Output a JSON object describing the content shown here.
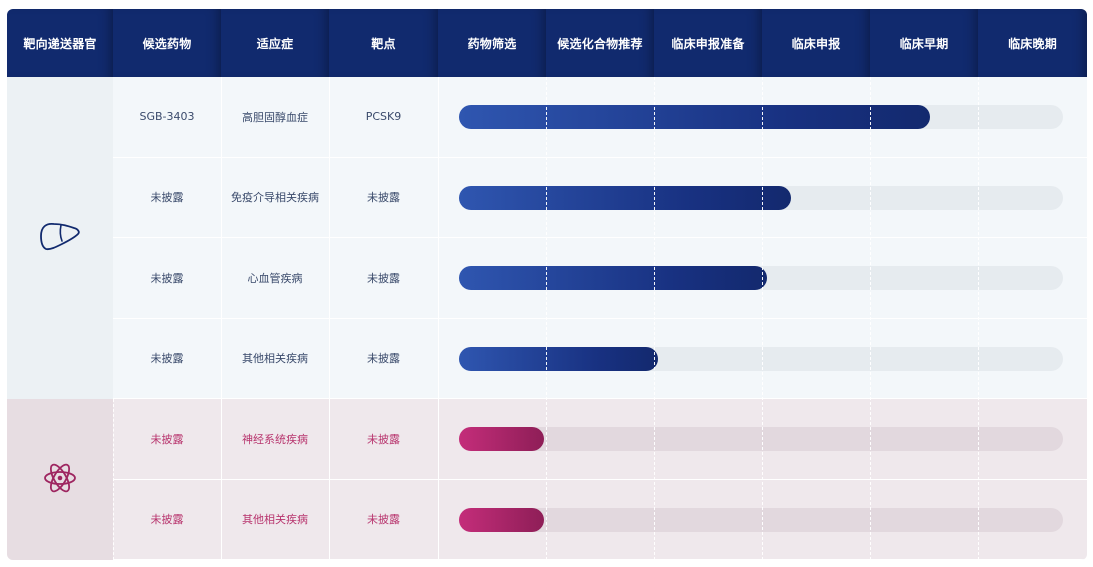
{
  "header": {
    "columns": [
      "靶向递送器官",
      "候选药物",
      "适应症",
      "靶点",
      "药物筛选",
      "候选化合物推荐",
      "临床申报准备",
      "临床申报",
      "临床早期",
      "临床晚期"
    ]
  },
  "groups": [
    {
      "organ_icon": "liver-icon",
      "color": "#112a6e"
    },
    {
      "organ_icon": "atom-icon",
      "color": "#b8356e"
    }
  ],
  "rows": [
    {
      "candidate": "SGB-3403",
      "indication": "高胆固醇血症",
      "target": "PCSK9",
      "progress": 0.78,
      "group": 0
    },
    {
      "candidate": "未披露",
      "indication": "免疫介导相关疾病",
      "target": "未披露",
      "progress": 0.55,
      "group": 0
    },
    {
      "candidate": "未披露",
      "indication": "心血管疾病",
      "target": "未披露",
      "progress": 0.51,
      "group": 0
    },
    {
      "candidate": "未披露",
      "indication": "其他相关疾病",
      "target": "未披露",
      "progress": 0.33,
      "group": 0
    },
    {
      "candidate": "未披露",
      "indication": "神经系统疾病",
      "target": "未披露",
      "progress": 0.14,
      "group": 1
    },
    {
      "candidate": "未披露",
      "indication": "其他相关疾病",
      "target": "未披露",
      "progress": 0.14,
      "group": 1
    }
  ]
}
